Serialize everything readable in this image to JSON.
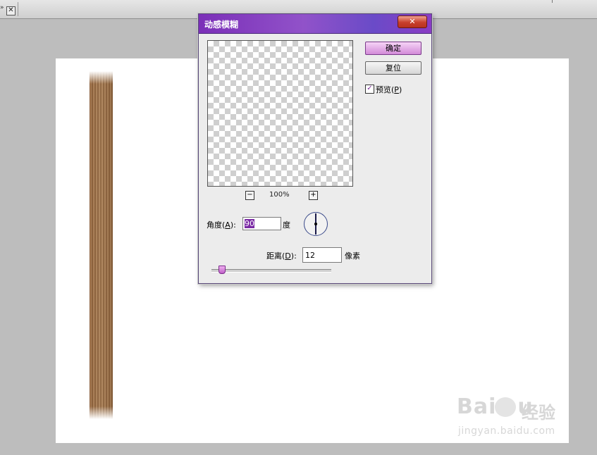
{
  "topbar": {
    "close_symbol": "✕",
    "arrow_symbol": "»"
  },
  "watermark": {
    "logo_text": "Bai",
    "logo_suffix": "u",
    "cn_text": "经验",
    "url": "jingyan.baidu.com"
  },
  "dialog": {
    "title": "动感模糊",
    "close_symbol": "✕",
    "ok_label": "确定",
    "reset_label": "复位",
    "preview": {
      "checked": true,
      "label_prefix": "预览(",
      "label_key": "P",
      "label_suffix": ")"
    },
    "zoom": {
      "minus": "−",
      "plus": "+",
      "level": "100%"
    },
    "angle": {
      "label_prefix": "角度(",
      "label_key": "A",
      "label_suffix": "):",
      "value": "90",
      "unit": "度"
    },
    "distance": {
      "label_prefix": "距离(",
      "label_key": "D",
      "label_suffix": "):",
      "value": "12",
      "unit": "像素",
      "slider_fraction": 0.06
    }
  },
  "colors": {
    "title_gradient_start": "#7b2fb8",
    "primary_button": "#d28ad8",
    "selection": "#7a2aa4",
    "wood": "#a87e57"
  }
}
